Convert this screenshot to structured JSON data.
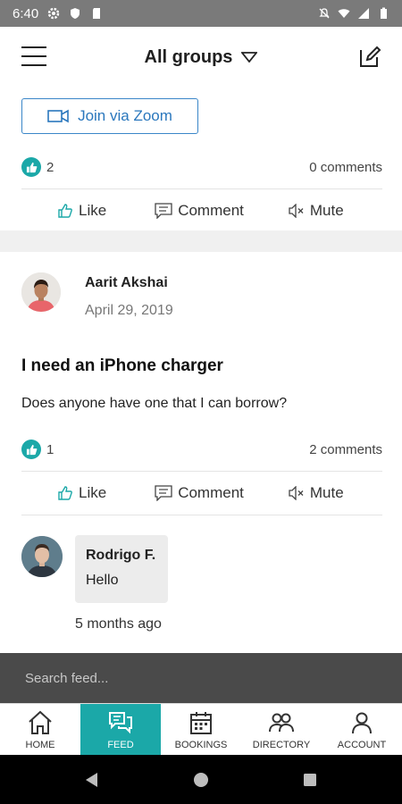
{
  "status": {
    "time": "6:40"
  },
  "header": {
    "title": "All groups"
  },
  "zoom": {
    "label": "Join via Zoom"
  },
  "post1": {
    "likes": "2",
    "comments": "0 comments"
  },
  "actions": {
    "like": "Like",
    "comment": "Comment",
    "mute": "Mute"
  },
  "post2": {
    "author": "Aarit Akshai",
    "date": "April 29, 2019",
    "title": "I need an iPhone charger",
    "body": "Does anyone have one that I can borrow?",
    "likes": "1",
    "comments": "2 comments"
  },
  "comment": {
    "name": "Rodrigo F.",
    "text": "Hello",
    "time": "5 months ago"
  },
  "search": {
    "placeholder": "Search feed..."
  },
  "tabs": [
    {
      "label": "HOME",
      "icon": "home-icon"
    },
    {
      "label": "FEED",
      "icon": "feed-icon",
      "active": true
    },
    {
      "label": "BOOKINGS",
      "icon": "calendar-icon"
    },
    {
      "label": "DIRECTORY",
      "icon": "people-icon"
    },
    {
      "label": "ACCOUNT",
      "icon": "person-icon"
    }
  ],
  "colors": {
    "accent": "#1ba8a8",
    "link": "#2a77bd",
    "status_bar": "#7a7a7a"
  }
}
